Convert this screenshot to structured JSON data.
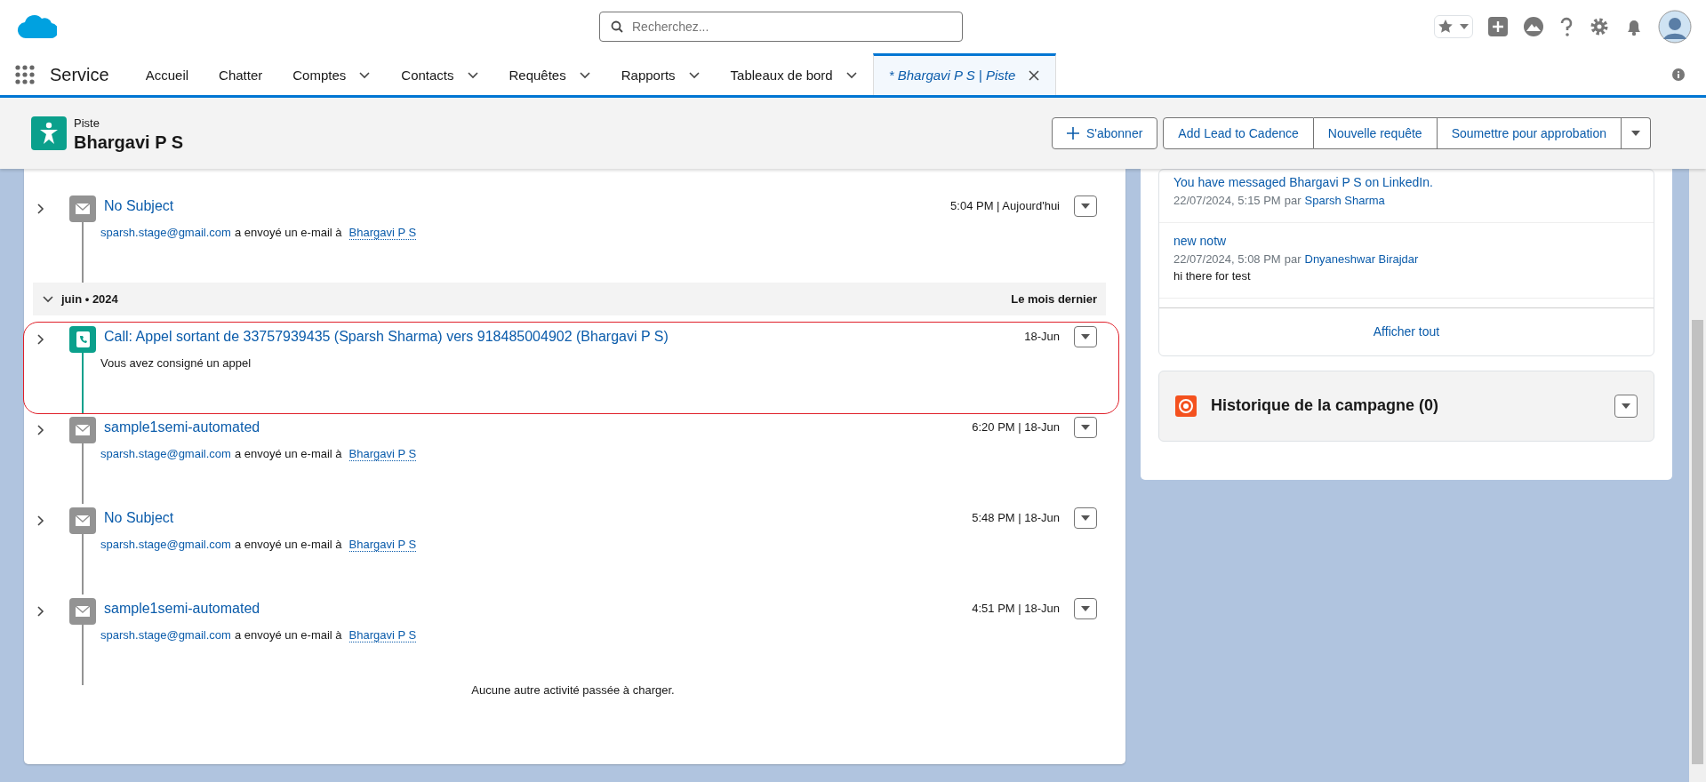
{
  "app": {
    "name": "Service"
  },
  "search": {
    "placeholder": "Recherchez..."
  },
  "nav_tabs": [
    {
      "label": "Accueil",
      "dropdown": false,
      "selected": false,
      "closable": false
    },
    {
      "label": "Chatter",
      "dropdown": false,
      "selected": false,
      "closable": false
    },
    {
      "label": "Comptes",
      "dropdown": true,
      "selected": false,
      "closable": false
    },
    {
      "label": "Contacts",
      "dropdown": true,
      "selected": false,
      "closable": false
    },
    {
      "label": "Requêtes",
      "dropdown": true,
      "selected": false,
      "closable": false
    },
    {
      "label": "Rapports",
      "dropdown": true,
      "selected": false,
      "closable": false
    },
    {
      "label": "Tableaux de bord",
      "dropdown": true,
      "selected": false,
      "closable": false
    },
    {
      "label": "* Bhargavi P S | Piste",
      "dropdown": false,
      "selected": true,
      "closable": true
    }
  ],
  "record": {
    "type": "Piste",
    "name": "Bhargavi P S"
  },
  "actions": [
    {
      "kind": "follow",
      "label": "S'abonner"
    },
    {
      "kind": "plain",
      "label": "Add Lead to Cadence"
    },
    {
      "kind": "plain",
      "label": "Nouvelle requête"
    },
    {
      "kind": "plain",
      "label": "Soumettre pour approbation"
    },
    {
      "kind": "menu"
    }
  ],
  "activities": [
    {
      "kind": "email",
      "title": "No Subject",
      "time": "5:04 PM | Aujourd'hui",
      "sender": "sparsh.stage@gmail.com",
      "verb": "a envoyé un e-mail à",
      "recipient": "Bhargavi P S",
      "highlighted": false
    },
    {
      "kind": "group",
      "label": "juin • 2024",
      "note": "Le mois dernier",
      "expanded": true
    },
    {
      "kind": "call",
      "title": "Call: Appel sortant de 33757939435 (Sparsh Sharma) vers 918485004902 (Bhargavi P S)",
      "time": "18-Jun",
      "description": "Vous avez consigné un appel",
      "highlighted": true
    },
    {
      "kind": "email",
      "title": "sample1semi-automated",
      "time": "6:20 PM | 18-Jun",
      "sender": "sparsh.stage@gmail.com",
      "verb": "a envoyé un e-mail à",
      "recipient": "Bhargavi P S",
      "highlighted": false
    },
    {
      "kind": "email",
      "title": "No Subject",
      "time": "5:48 PM | 18-Jun",
      "sender": "sparsh.stage@gmail.com",
      "verb": "a envoyé un e-mail à",
      "recipient": "Bhargavi P S",
      "highlighted": false
    },
    {
      "kind": "email",
      "title": "sample1semi-automated",
      "time": "4:51 PM | 18-Jun",
      "sender": "sparsh.stage@gmail.com",
      "verb": "a envoyé un e-mail à",
      "recipient": "Bhargavi P S",
      "highlighted": false
    }
  ],
  "activities_footer": "Aucune autre activité passée à charger.",
  "notes": [
    {
      "title": "You have messaged Bhargavi P S on LinkedIn.",
      "date": "22/07/2024, 5:15 PM",
      "by": "par",
      "author": "Sparsh Sharma"
    },
    {
      "title": "new notw",
      "date": "22/07/2024, 5:08 PM",
      "by": "par",
      "author": "Dnyaneshwar Birajdar",
      "body": "hi there for test"
    }
  ],
  "notes_footer": "Afficher tout",
  "campaign": {
    "title": "Historique de la campagne (0)"
  }
}
